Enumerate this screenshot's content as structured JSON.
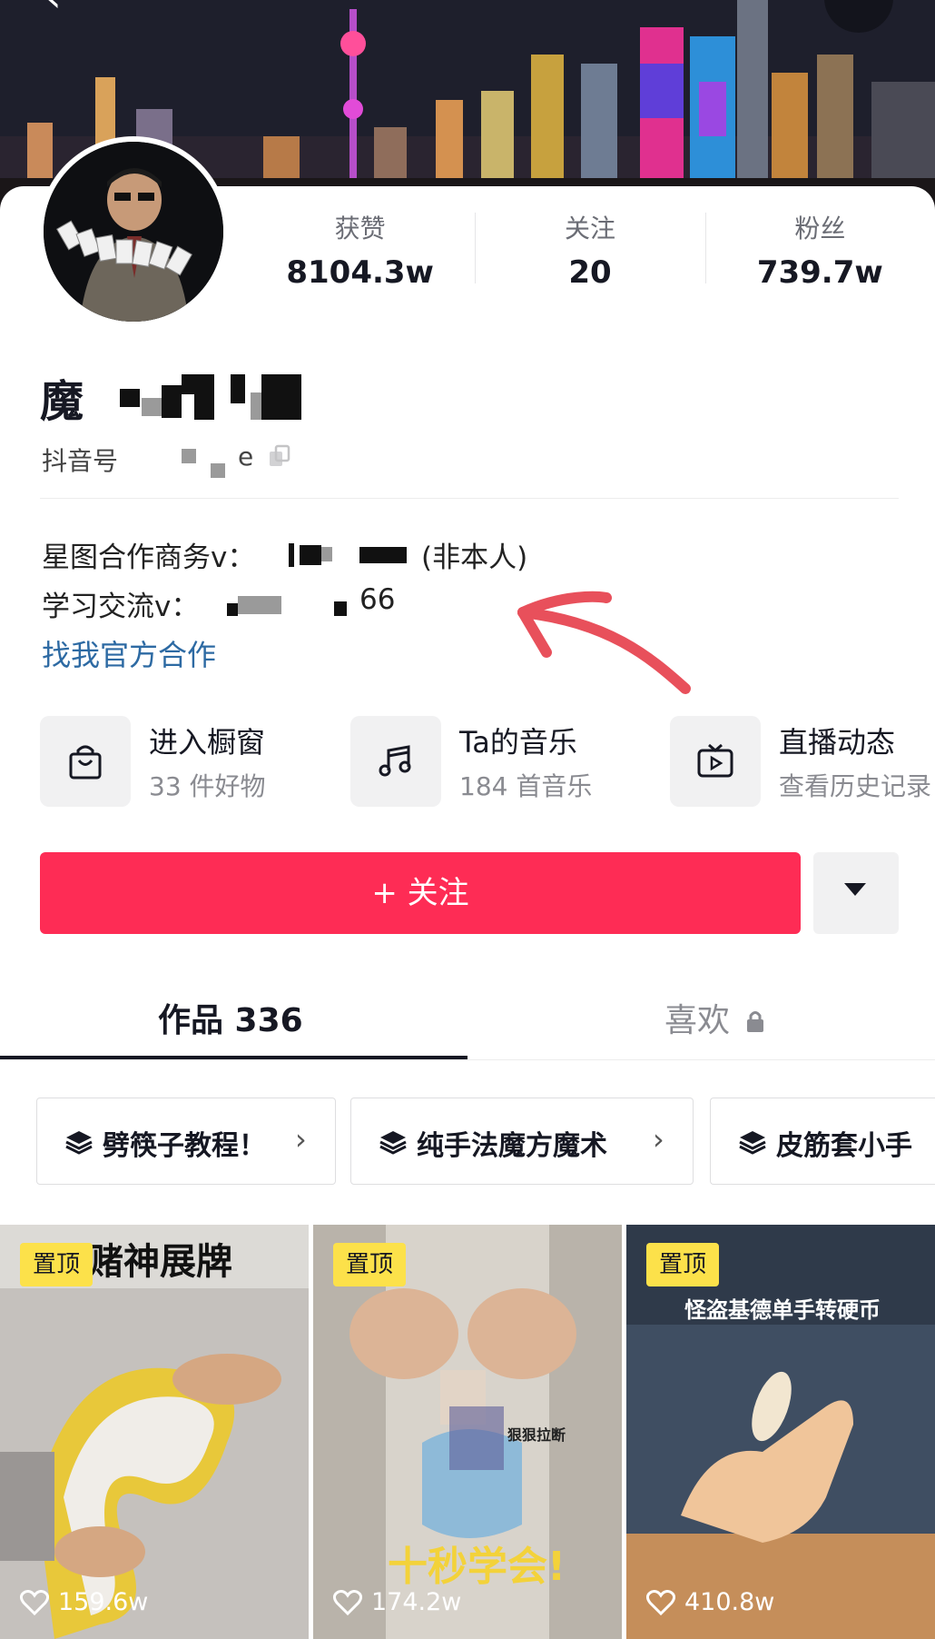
{
  "nav": {
    "back_icon": "chevron-left-icon",
    "more_icon": "ellipsis-icon",
    "more_glyph": "···",
    "back_glyph": "‹"
  },
  "stats": [
    {
      "label": "获赞",
      "value": "8104.3w"
    },
    {
      "label": "关注",
      "value": "20"
    },
    {
      "label": "粉丝",
      "value": "739.7w"
    }
  ],
  "profile": {
    "name": "魔",
    "douyin_id_label": "抖音号",
    "douyin_id_visible": "e",
    "bio_line1": "星图合作商务v：",
    "bio_line1_suffix": "(非本人)",
    "bio_line2": "学习交流v：",
    "bio_line2_suffix": "66",
    "official_link": "找我官方合作"
  },
  "features": [
    {
      "icon": "shopping-bag-icon",
      "title": "进入橱窗",
      "subtitle": "33 件好物"
    },
    {
      "icon": "music-note-icon",
      "title": "Ta的音乐",
      "subtitle": "184 首音乐"
    },
    {
      "icon": "tv-play-icon",
      "title": "直播动态",
      "subtitle": "查看历史记录"
    }
  ],
  "actions": {
    "follow_label": "+ 关注",
    "more_icon": "triangle-down-icon"
  },
  "tabs": [
    {
      "label": "作品 336",
      "active": true
    },
    {
      "label": "喜欢",
      "locked": true
    }
  ],
  "collections": [
    {
      "label": "劈筷子教程！",
      "arrow": "›"
    },
    {
      "label": "纯手法魔方魔术",
      "arrow": "›"
    },
    {
      "label": "皮筋套小手"
    }
  ],
  "videos": [
    {
      "pinned_label": "置顶",
      "overlay_text": "赌神展牌",
      "likes": "159.6w"
    },
    {
      "pinned_label": "置顶",
      "overlay_text": "十秒学会!",
      "overlay_small": "狠狠拉断",
      "likes": "174.2w"
    },
    {
      "pinned_label": "置顶",
      "overlay_text": "怪盗基德单手转硬币",
      "likes": "410.8w"
    }
  ],
  "colors": {
    "accent": "#fe2c55",
    "link": "#2d6aa3",
    "pin": "#fce14a",
    "annotation_arrow": "#e8505b"
  }
}
